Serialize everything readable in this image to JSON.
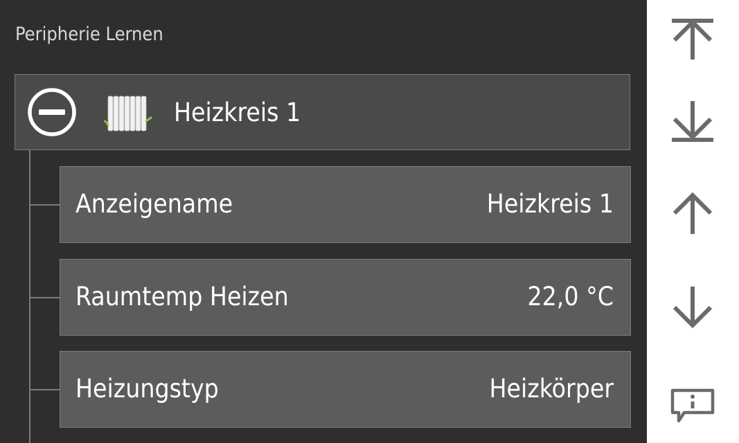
{
  "page": {
    "title": "Peripherie Lernen"
  },
  "group": {
    "title": "Heizkreis 1",
    "icon": "radiator-icon",
    "toggle_icon": "minus-circle-icon"
  },
  "rows": [
    {
      "label": "Anzeigename",
      "value": "Heizkreis 1"
    },
    {
      "label": "Raumtemp Heizen",
      "value": "22,0 °C"
    },
    {
      "label": "Heizungstyp",
      "value": "Heizkörper"
    }
  ],
  "sidebar": {
    "buttons": [
      {
        "icon": "scroll-to-top-icon"
      },
      {
        "icon": "scroll-to-bottom-icon"
      },
      {
        "icon": "arrow-up-icon"
      },
      {
        "icon": "arrow-down-icon"
      },
      {
        "icon": "info-message-icon"
      }
    ]
  },
  "colors": {
    "background": "#2e2e2e",
    "group_header": "#4a4a4a",
    "row": "#5c5c5c",
    "sidebar": "#ffffff",
    "sidebar_icon": "#6b6b6b",
    "radiator_accent": "#8cc63f"
  }
}
